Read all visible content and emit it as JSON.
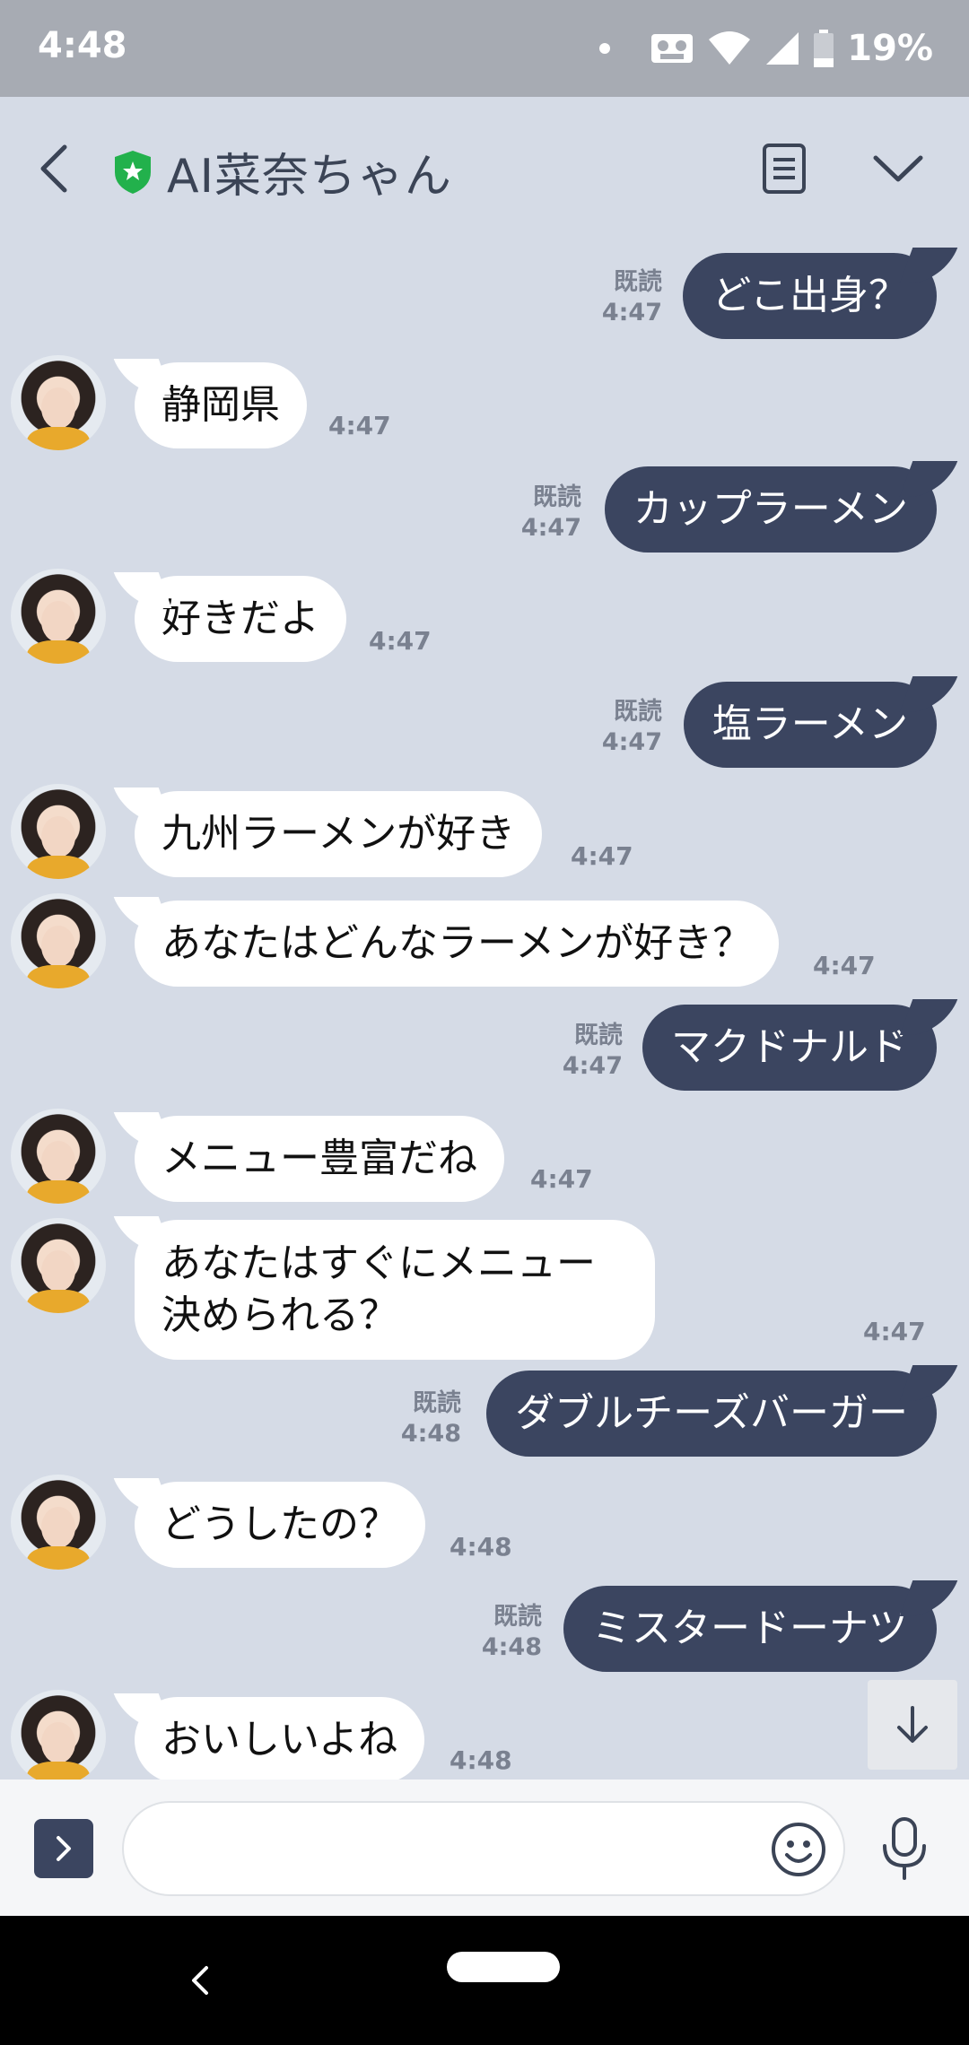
{
  "status_bar": {
    "time": "4:48",
    "battery": "19%"
  },
  "header": {
    "title": "AI菜奈ちゃん"
  },
  "messages": [
    {
      "dir": "out",
      "text": "どこ出身？",
      "read": "既読",
      "time": "4:47"
    },
    {
      "dir": "in",
      "text": "静岡県",
      "time": "4:47"
    },
    {
      "dir": "out",
      "text": "カップラーメン",
      "read": "既読",
      "time": "4:47"
    },
    {
      "dir": "in",
      "text": "好きだよ",
      "time": "4:47"
    },
    {
      "dir": "out",
      "text": "塩ラーメン",
      "read": "既読",
      "time": "4:47"
    },
    {
      "dir": "in",
      "text": "九州ラーメンが好き",
      "time": "4:47"
    },
    {
      "dir": "in",
      "text": "あなたはどんなラーメンが好き？",
      "time": "4:47"
    },
    {
      "dir": "out",
      "text": "マクドナルド",
      "read": "既読",
      "time": "4:47"
    },
    {
      "dir": "in",
      "text": "メニュー豊富だね",
      "time": "4:47"
    },
    {
      "dir": "in",
      "text": "あなたはすぐにメニュー決められる？",
      "time": "4:47"
    },
    {
      "dir": "out",
      "text": "ダブルチーズバーガー",
      "read": "既読",
      "time": "4:48"
    },
    {
      "dir": "in",
      "text": "どうしたの？",
      "time": "4:48"
    },
    {
      "dir": "out",
      "text": "ミスタードーナツ",
      "read": "既読",
      "time": "4:48"
    },
    {
      "dir": "in",
      "text": "おいしいよね",
      "time": "4:48"
    }
  ],
  "input": {
    "placeholder": "",
    "value": ""
  },
  "icons": {
    "back": "chevron-left-icon",
    "verified": "shield-star-icon",
    "notes": "notes-icon",
    "menu": "chevron-down-icon",
    "scroll": "arrow-down-icon",
    "expand": "chevron-right-icon",
    "emoji": "smiley-icon",
    "mic": "microphone-icon"
  },
  "colors": {
    "background": "#d5dbe6",
    "outgoing": "#3b4560",
    "incoming": "#ffffff",
    "verified": "#22b14c"
  }
}
